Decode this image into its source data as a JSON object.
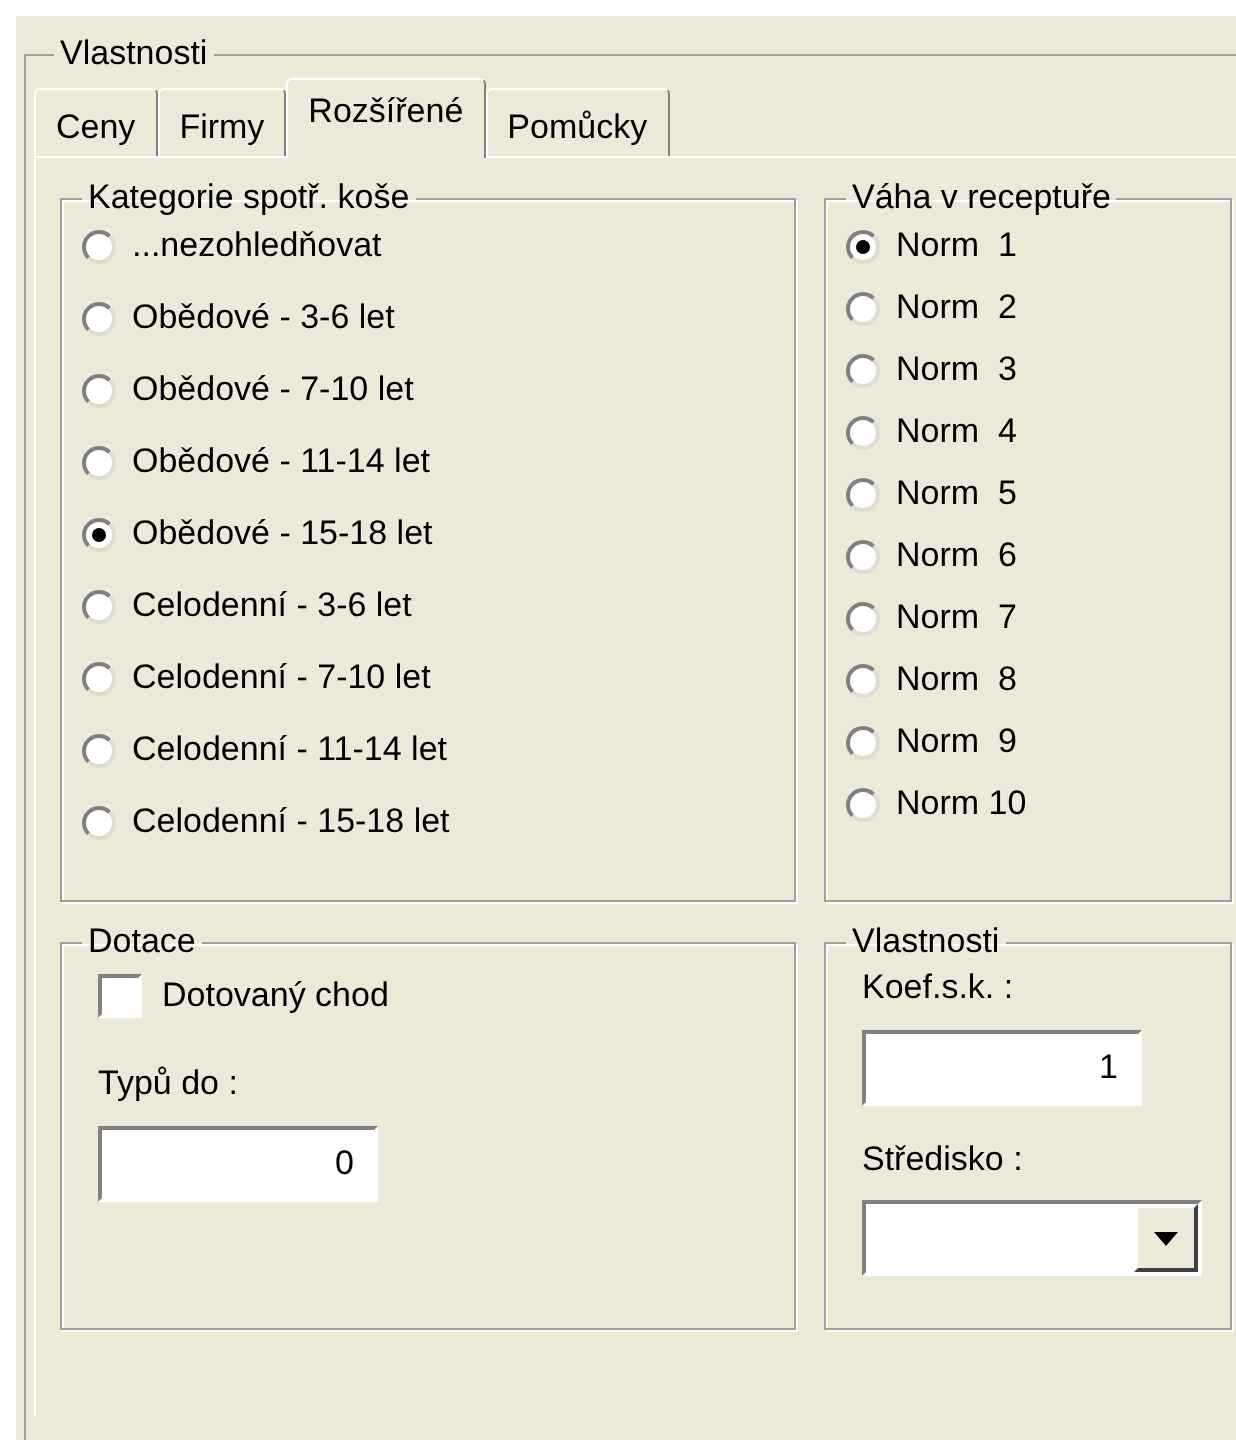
{
  "group_title": "Vlastnosti",
  "tabs": [
    {
      "label": "Ceny",
      "selected": false
    },
    {
      "label": "Firmy",
      "selected": false
    },
    {
      "label": "Rozšířené",
      "selected": true
    },
    {
      "label": "Pomůcky",
      "selected": false
    }
  ],
  "basket_category": {
    "title": "Kategorie spotř. koše",
    "options": [
      {
        "label": "...nezohledňovat",
        "selected": false
      },
      {
        "label": "Obědové - 3-6 let",
        "selected": false
      },
      {
        "label": "Obědové - 7-10 let",
        "selected": false
      },
      {
        "label": "Obědové - 11-14 let",
        "selected": false
      },
      {
        "label": "Obědové - 15-18 let",
        "selected": true
      },
      {
        "label": "Celodenní - 3-6 let",
        "selected": false
      },
      {
        "label": "Celodenní - 7-10 let",
        "selected": false
      },
      {
        "label": "Celodenní - 11-14 let",
        "selected": false
      },
      {
        "label": "Celodenní - 15-18 let",
        "selected": false
      }
    ]
  },
  "recipe_weight": {
    "title": "Váha v receptuře",
    "options": [
      {
        "label": "Norm  1",
        "selected": true
      },
      {
        "label": "Norm  2",
        "selected": false
      },
      {
        "label": "Norm  3",
        "selected": false
      },
      {
        "label": "Norm  4",
        "selected": false
      },
      {
        "label": "Norm  5",
        "selected": false
      },
      {
        "label": "Norm  6",
        "selected": false
      },
      {
        "label": "Norm  7",
        "selected": false
      },
      {
        "label": "Norm  8",
        "selected": false
      },
      {
        "label": "Norm  9",
        "selected": false
      },
      {
        "label": "Norm 10",
        "selected": false
      }
    ]
  },
  "subsidy": {
    "title": "Dotace",
    "checkbox": {
      "label": "Dotovaný chod",
      "checked": false
    },
    "field_label": "Typů do :",
    "field_value": "0"
  },
  "properties": {
    "title": "Vlastnosti",
    "coef_label": "Koef.s.k. :",
    "coef_value": "1",
    "center_label": "Středisko :"
  }
}
